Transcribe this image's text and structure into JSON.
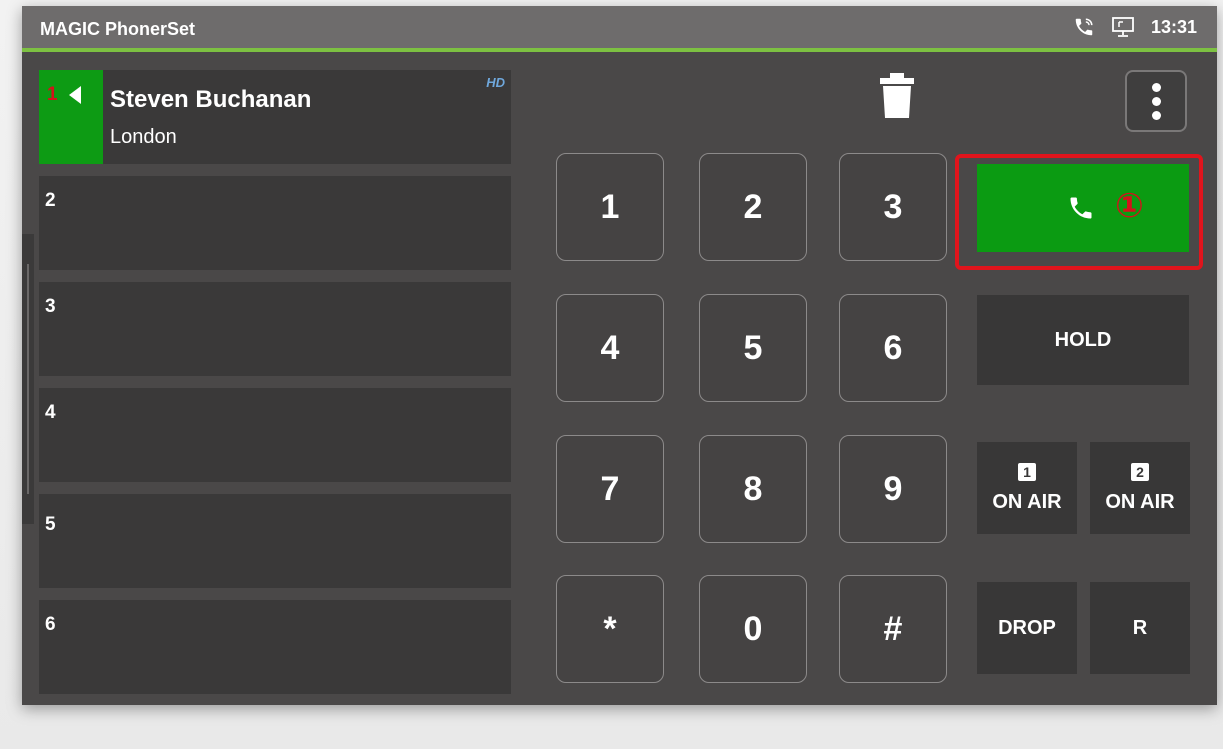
{
  "app": {
    "title": "MAGIC PhonerSet",
    "clock": "13:31",
    "status_icons": [
      "call-ringing-icon",
      "network-icon"
    ]
  },
  "lines": [
    {
      "number": "1",
      "name": "Steven Buchanan",
      "city": "London",
      "badge": "HD",
      "active": true
    },
    {
      "number": "2",
      "name": "",
      "city": "",
      "active": false
    },
    {
      "number": "3",
      "name": "",
      "city": "",
      "active": false
    },
    {
      "number": "4",
      "name": "",
      "city": "",
      "active": false
    },
    {
      "number": "5",
      "name": "",
      "city": "",
      "active": false
    },
    {
      "number": "6",
      "name": "",
      "city": "",
      "active": false
    }
  ],
  "keypad": {
    "keys": [
      "1",
      "2",
      "3",
      "4",
      "5",
      "6",
      "7",
      "8",
      "9",
      "*",
      "0",
      "#"
    ]
  },
  "actions": {
    "call_icon": "phone-icon",
    "call_step_marker": "①",
    "hold": "HOLD",
    "on_air_1_num": "1",
    "on_air_1": "ON AIR",
    "on_air_2_num": "2",
    "on_air_2": "ON AIR",
    "drop": "DROP",
    "r": "R"
  },
  "colors": {
    "accent_green": "#0b9b12",
    "highlight_red": "#e0141c",
    "hd_blue": "#6fa8dc"
  }
}
